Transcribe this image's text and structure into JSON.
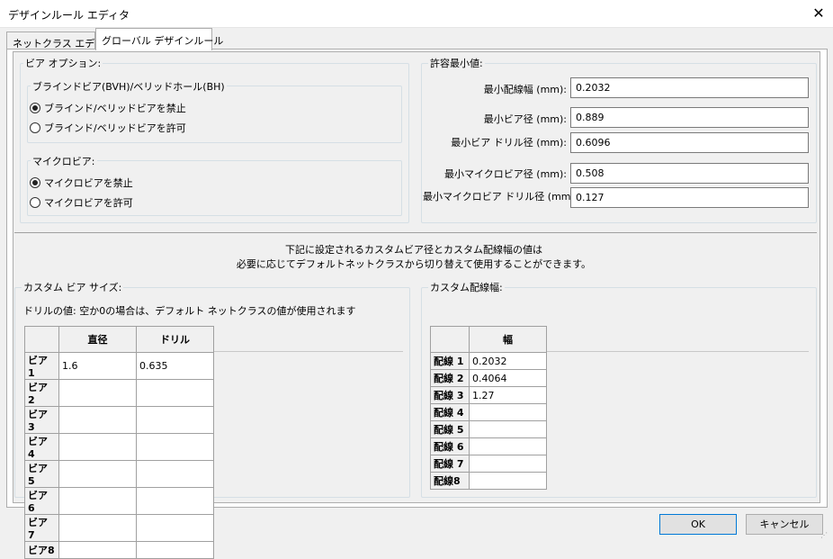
{
  "window": {
    "title": "デザインルール エディタ",
    "close_glyph": "✕"
  },
  "tabs": [
    {
      "label": "ネットクラス エディタ"
    },
    {
      "label": "グローバル デザインルール"
    }
  ],
  "via_options": {
    "label": "ビア オプション:",
    "blind": {
      "label": "ブラインドビア(BVH)/ベリッドホール(BH)",
      "options": [
        "ブラインド/ベリッドビアを禁止",
        "ブラインド/ベリッドビアを許可"
      ],
      "selected": 0
    },
    "micro": {
      "label": "マイクロビア:",
      "options": [
        "マイクロビアを禁止",
        "マイクロビアを許可"
      ],
      "selected": 0
    }
  },
  "min_values": {
    "label": "許容最小値:",
    "fields": [
      {
        "label": "最小配線幅 (mm):",
        "value": "0.2032"
      },
      {
        "label": "最小ビア径 (mm):",
        "value": "0.889"
      },
      {
        "label": "最小ビア ドリル径 (mm):",
        "value": "0.6096"
      },
      {
        "label": "最小マイクロビア径 (mm):",
        "value": "0.508"
      },
      {
        "label": "最小マイクロビア ドリル径 (mm):",
        "value": "0.127"
      }
    ]
  },
  "note": {
    "line1": "下記に設定されるカスタムビア径とカスタム配線幅の値は",
    "line2": "必要に応じてデフォルトネットクラスから切り替えて使用することができます。"
  },
  "custom_via": {
    "label": "カスタム ビア サイズ:",
    "hint": "ドリルの値: 空か0の場合は、デフォルト ネットクラスの値が使用されます",
    "columns": [
      "直径",
      "ドリル"
    ],
    "rows": [
      {
        "label": "ビア 1",
        "values": [
          "1.6",
          "0.635"
        ]
      },
      {
        "label": "ビア 2",
        "values": [
          "",
          ""
        ]
      },
      {
        "label": "ビア 3",
        "values": [
          "",
          ""
        ]
      },
      {
        "label": "ビア 4",
        "values": [
          "",
          ""
        ]
      },
      {
        "label": "ビア 5",
        "values": [
          "",
          ""
        ]
      },
      {
        "label": "ビア 6",
        "values": [
          "",
          ""
        ]
      },
      {
        "label": "ビア 7",
        "values": [
          "",
          ""
        ]
      },
      {
        "label": "ビア8",
        "values": [
          "",
          ""
        ]
      }
    ]
  },
  "custom_track": {
    "label": "カスタム配線幅:",
    "columns": [
      "幅"
    ],
    "rows": [
      {
        "label": "配線 1",
        "values": [
          "0.2032"
        ]
      },
      {
        "label": "配線 2",
        "values": [
          "0.4064"
        ]
      },
      {
        "label": "配線 3",
        "values": [
          "1.27"
        ]
      },
      {
        "label": "配線 4",
        "values": [
          ""
        ]
      },
      {
        "label": "配線 5",
        "values": [
          ""
        ]
      },
      {
        "label": "配線 6",
        "values": [
          ""
        ]
      },
      {
        "label": "配線 7",
        "values": [
          ""
        ]
      },
      {
        "label": "配線8",
        "values": [
          ""
        ]
      }
    ]
  },
  "buttons": {
    "ok": "OK",
    "cancel": "キャンセル"
  }
}
